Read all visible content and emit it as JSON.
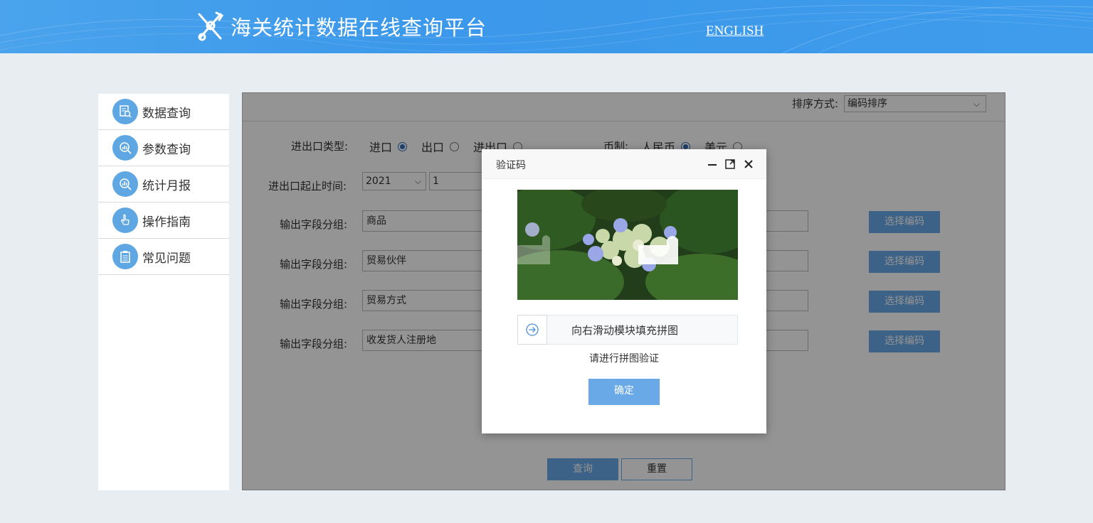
{
  "header": {
    "site_title": "海关统计数据在线查询平台",
    "english_link": "ENGLISH"
  },
  "sidebar": {
    "items": [
      {
        "label": "数据查询",
        "icon": "document-search-icon"
      },
      {
        "label": "参数查询",
        "icon": "magnifier-chart-icon"
      },
      {
        "label": "统计月报",
        "icon": "magnifier-chart-icon"
      },
      {
        "label": "操作指南",
        "icon": "hand-pointer-icon"
      },
      {
        "label": "常见问题",
        "icon": "clipboard-icon"
      }
    ]
  },
  "form": {
    "sort_label": "排序方式:",
    "sort_value": "编码排序",
    "trade_type_label": "进出口类型:",
    "trade_options": [
      {
        "label": "进口",
        "checked": true
      },
      {
        "label": "出口",
        "checked": false
      },
      {
        "label": "进出口",
        "checked": false
      }
    ],
    "currency_label": "币制:",
    "currency_options": [
      {
        "label": "人民币",
        "checked": true
      },
      {
        "label": "美元",
        "checked": false
      }
    ],
    "period_label": "进出口起止时间:",
    "start_year": "2021",
    "start_month": "1",
    "field_group_label": "输出字段分组:",
    "field_groups": [
      "商品",
      "贸易伙伴",
      "贸易方式",
      "收发货人注册地"
    ],
    "select_code_label": "选择编码",
    "query_label": "查询",
    "reset_label": "重置"
  },
  "captcha": {
    "title": "验证码",
    "slider_text": "向右滑动模块填充拼图",
    "hint": "请进行拼图验证",
    "confirm_label": "确定"
  },
  "colors": {
    "header_blue": "#3b98ea",
    "accent_blue": "#6aa9e8",
    "radio_blue": "#2f6fb8"
  }
}
